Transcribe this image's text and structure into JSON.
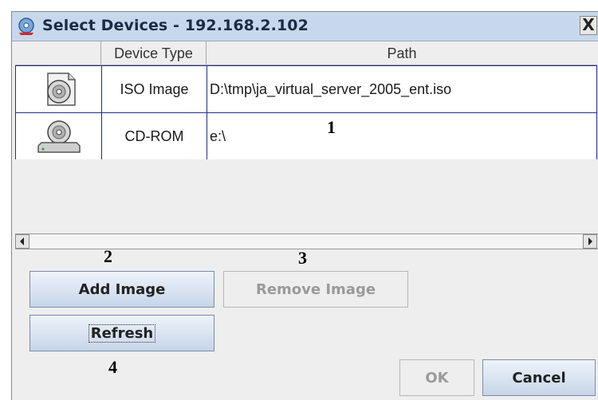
{
  "window": {
    "title": "Select Devices - 192.168.2.102",
    "close": "X"
  },
  "table": {
    "columns": [
      "",
      "Device Type",
      "Path"
    ],
    "rows": [
      {
        "icon": "iso-image-icon",
        "type": "ISO Image",
        "path": "D:\\tmp\\ja_virtual_server_2005_ent.iso"
      },
      {
        "icon": "cd-rom-drive-icon",
        "type": "CD-ROM",
        "path": "e:\\"
      }
    ]
  },
  "buttons": {
    "add_image": "Add Image",
    "remove_image": "Remove Image",
    "refresh": "Refresh",
    "ok": "OK",
    "cancel": "Cancel"
  },
  "callouts": [
    "1",
    "2",
    "3",
    "4"
  ],
  "colors": {
    "selection_border": "#1f2f8a",
    "button_top": "#eef3fb",
    "button_bottom": "#c7d5e9"
  }
}
